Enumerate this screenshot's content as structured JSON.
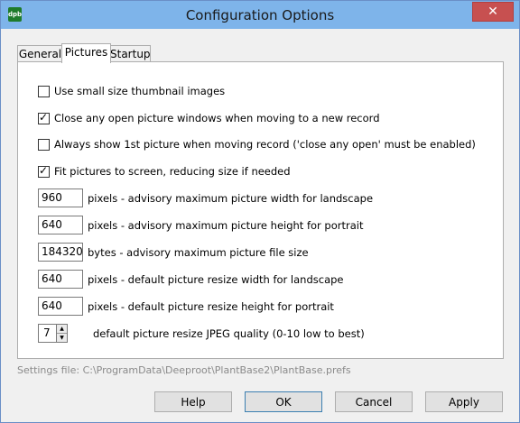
{
  "window": {
    "title": "Configuration Options",
    "app_icon_text": "dpb",
    "close_glyph": "✕"
  },
  "tabs": [
    {
      "label": "General",
      "active": false
    },
    {
      "label": "Pictures",
      "active": true
    },
    {
      "label": "Startup",
      "active": false
    }
  ],
  "options": {
    "small_thumbs": {
      "label": "Use small size thumbnail images",
      "checked": false
    },
    "close_open": {
      "label": "Close any open picture windows when moving to a new record",
      "checked": true
    },
    "always_first": {
      "label": "Always show 1st picture when moving record ('close any open' must be enabled)",
      "checked": false
    },
    "fit_screen": {
      "label": "Fit pictures to screen, reducing size if needed",
      "checked": true
    }
  },
  "fields": {
    "max_width": {
      "value": "960",
      "label": "pixels - advisory maximum picture width for landscape"
    },
    "max_height": {
      "value": "640",
      "label": "pixels - advisory maximum picture height for portrait"
    },
    "max_file_size": {
      "value": "184320",
      "label": "bytes - advisory maximum picture file size"
    },
    "resize_width": {
      "value": "640",
      "label": "pixels - default picture resize width for landscape"
    },
    "resize_height": {
      "value": "640",
      "label": "pixels - default picture resize height for portrait"
    },
    "jpeg_quality": {
      "value": "7",
      "label": "default picture resize JPEG quality (0-10 low to best)"
    }
  },
  "settings_file": "Settings file: C:\\ProgramData\\Deeproot\\PlantBase2\\PlantBase.prefs",
  "buttons": {
    "help": "Help",
    "ok": "OK",
    "cancel": "Cancel",
    "apply": "Apply"
  }
}
